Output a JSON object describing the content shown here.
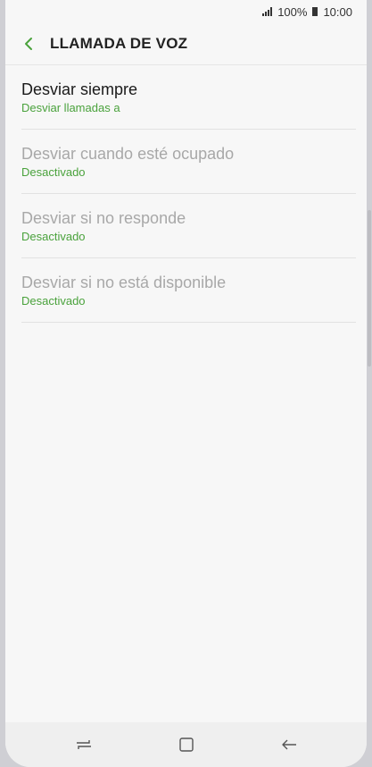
{
  "status_bar": {
    "battery_percent": "100%",
    "time": "10:00",
    "icons": [
      "signal-icon",
      "battery-icon"
    ]
  },
  "header": {
    "title": "LLAMADA DE VOZ",
    "back_icon": "chevron-left-icon"
  },
  "items": [
    {
      "title": "Desviar siempre",
      "subtitle": "Desviar llamadas a",
      "enabled": true
    },
    {
      "title": "Desviar cuando esté ocupado",
      "subtitle": "Desactivado",
      "enabled": false
    },
    {
      "title": "Desviar si no responde",
      "subtitle": "Desactivado",
      "enabled": false
    },
    {
      "title": "Desviar si no está disponible",
      "subtitle": "Desactivado",
      "enabled": false
    }
  ],
  "navbar": {
    "icons": [
      "recents-icon",
      "home-icon",
      "back-icon"
    ]
  },
  "colors": {
    "accent": "#4aa23c",
    "disabled_text": "#a8a8a8",
    "background": "#f7f7f7"
  }
}
